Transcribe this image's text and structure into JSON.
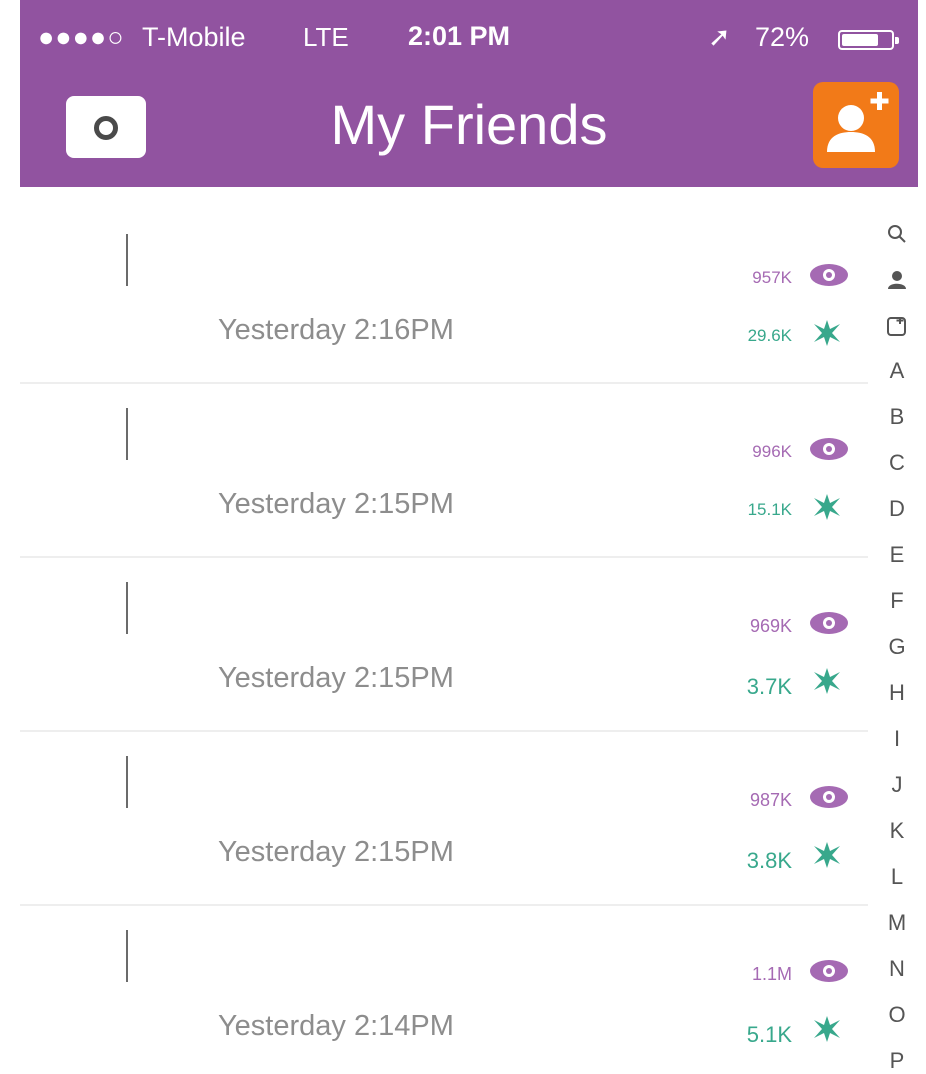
{
  "status_bar": {
    "signal": "●●●●○",
    "carrier": "T-Mobile",
    "network": "LTE",
    "time": "2:01 PM",
    "location_arrow": "➚",
    "battery": "72%"
  },
  "header": {
    "title": "My Friends",
    "camera_icon": "camera-icon",
    "add_friend_icon": "add-friend-icon"
  },
  "friends": [
    {
      "timestamp": "Yesterday 2:16PM",
      "views": "957K",
      "screenshots": "29.6K"
    },
    {
      "timestamp": "Yesterday 2:15PM",
      "views": "996K",
      "screenshots": "15.1K"
    },
    {
      "timestamp": "Yesterday 2:15PM",
      "views": "969K",
      "screenshots": "3.7K"
    },
    {
      "timestamp": "Yesterday 2:15PM",
      "views": "987K",
      "screenshots": "3.8K"
    },
    {
      "timestamp": "Yesterday 2:14PM",
      "views": "1.1M",
      "screenshots": "5.1K"
    }
  ],
  "index": [
    "A",
    "B",
    "C",
    "D",
    "E",
    "F",
    "G",
    "H",
    "I",
    "J",
    "K",
    "L",
    "M",
    "N",
    "O",
    "P"
  ],
  "colors": {
    "header": "#9153a0",
    "add_button": "#f27a18",
    "views": "#a56ab3",
    "screenshots": "#38a88c"
  }
}
